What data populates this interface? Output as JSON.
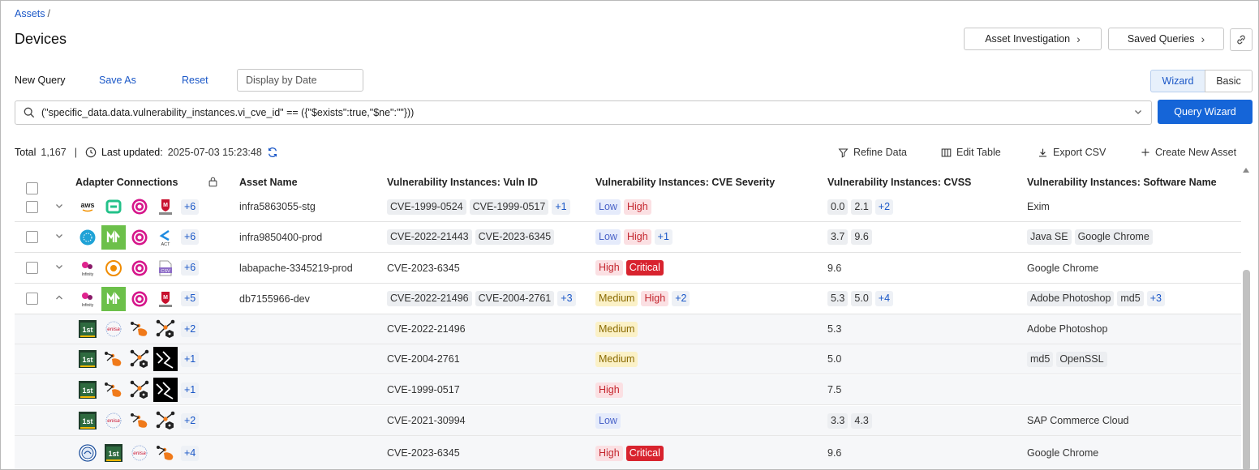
{
  "breadcrumb": {
    "root": "Assets",
    "sep": "/"
  },
  "page_title": "Devices",
  "header_buttons": {
    "asset_investigation": "Asset Investigation",
    "saved_queries": "Saved Queries"
  },
  "query_bar": {
    "new_query": "New Query",
    "save_as": "Save As",
    "reset": "Reset",
    "date_placeholder": "Display by Date",
    "wizard": "Wizard",
    "basic": "Basic",
    "expression": "(\"specific_data.data.vulnerability_instances.vi_cve_id\" == ({\"$exists\":true,\"$ne\":\"\"}))",
    "query_wizard": "Query Wizard"
  },
  "status": {
    "total_label": "Total",
    "total_value": "1,167",
    "updated_label": "Last updated:",
    "updated_value": "2025-07-03 15:23:48"
  },
  "toolbar": {
    "refine": "Refine Data",
    "edit_table": "Edit Table",
    "export": "Export CSV",
    "create": "Create New Asset"
  },
  "columns": {
    "adapters": "Adapter Connections",
    "asset_name": "Asset Name",
    "vuln_id": "Vulnerability Instances: Vuln ID",
    "severity": "Vulnerability Instances: CVE Severity",
    "cvss": "Vulnerability Instances: CVSS",
    "software": "Vulnerability Instances: Software Name"
  },
  "colors": {
    "accent": "#1565d8",
    "link": "#1a57c7",
    "critical": "#d8232e",
    "high_bg": "#fbe0e3",
    "medium_bg": "#fbf1c7",
    "low_bg": "#e5ebfb"
  },
  "rows": [
    {
      "expand": "down",
      "adapters": [
        "aws-icon",
        "bigfix-icon",
        "target-icon",
        "epo-icon"
      ],
      "adapters_more": "+6",
      "asset": "infra5863055-stg",
      "vuln_ids": [
        "CVE-1999-0524",
        "CVE-1999-0517"
      ],
      "vuln_more": "+1",
      "sev": [
        {
          "t": "Low",
          "k": "low"
        },
        {
          "t": "High",
          "k": "high"
        }
      ],
      "sev_more": "",
      "cvss": [
        "0.0",
        "2.1"
      ],
      "cvss_more": "+2",
      "software": [
        "Exim"
      ],
      "software_plain": true,
      "sw_more": ""
    },
    {
      "expand": "down",
      "adapters": [
        "globe-icon",
        "m-icon",
        "target-icon",
        "act-icon"
      ],
      "adapters_more": "+6",
      "asset": "infra9850400-prod",
      "vuln_ids": [
        "CVE-2022-21443",
        "CVE-2023-6345"
      ],
      "vuln_more": "",
      "sev": [
        {
          "t": "Low",
          "k": "low"
        },
        {
          "t": "High",
          "k": "high"
        }
      ],
      "sev_more": "+1",
      "cvss": [
        "3.7",
        "9.6"
      ],
      "cvss_more": "",
      "software": [
        "Java SE",
        "Google Chrome"
      ],
      "software_plain": false,
      "sw_more": ""
    },
    {
      "expand": "down",
      "adapters": [
        "infinity-icon",
        "sun-icon",
        "target-icon",
        "csv-icon"
      ],
      "adapters_more": "+6",
      "asset": "labapache-3345219-prod",
      "vuln_ids": [
        "CVE-2023-6345"
      ],
      "vuln_plain": true,
      "vuln_more": "",
      "sev": [
        {
          "t": "High",
          "k": "high"
        },
        {
          "t": "Critical",
          "k": "crit"
        }
      ],
      "sev_more": "",
      "cvss": [
        "9.6"
      ],
      "cvss_plain": true,
      "cvss_more": "",
      "software": [
        "Google Chrome"
      ],
      "software_plain": true,
      "sw_more": ""
    },
    {
      "expand": "up",
      "adapters": [
        "infinity-icon",
        "m-icon",
        "target-icon",
        "epo-icon"
      ],
      "adapters_more": "+5",
      "asset": "db7155966-dev",
      "vuln_ids": [
        "CVE-2022-21496",
        "CVE-2004-2761"
      ],
      "vuln_more": "+3",
      "sev": [
        {
          "t": "Medium",
          "k": "med"
        },
        {
          "t": "High",
          "k": "high"
        }
      ],
      "sev_more": "+2",
      "cvss": [
        "5.3",
        "5.0"
      ],
      "cvss_more": "+4",
      "software": [
        "Adobe Photoshop",
        "md5"
      ],
      "software_plain": false,
      "sw_more": "+3"
    }
  ],
  "sub_rows": [
    {
      "adapters": [
        "first-icon",
        "enisa-icon",
        "hand-icon",
        "nodes-icon"
      ],
      "adapters_more": "+2",
      "vuln_id": "CVE-2022-21496",
      "sev": [
        {
          "t": "Medium",
          "k": "med"
        }
      ],
      "cvss": [
        "5.3"
      ],
      "cvss_plain": true,
      "software": [
        "Adobe Photoshop"
      ],
      "software_plain": true
    },
    {
      "adapters": [
        "first-icon",
        "hand-icon",
        "nodes-icon",
        "dark-icon"
      ],
      "adapters_more": "+1",
      "vuln_id": "CVE-2004-2761",
      "sev": [
        {
          "t": "Medium",
          "k": "med"
        }
      ],
      "cvss": [
        "5.0"
      ],
      "cvss_plain": true,
      "software": [
        "md5",
        "OpenSSL"
      ],
      "software_plain": false
    },
    {
      "adapters": [
        "first-icon",
        "hand-icon",
        "nodes-icon",
        "dark-icon"
      ],
      "adapters_more": "+1",
      "vuln_id": "CVE-1999-0517",
      "sev": [
        {
          "t": "High",
          "k": "high"
        }
      ],
      "cvss": [
        "7.5"
      ],
      "cvss_plain": true,
      "software": [],
      "software_plain": true
    },
    {
      "adapters": [
        "first-icon",
        "enisa-icon",
        "hand-icon",
        "nodes-icon"
      ],
      "adapters_more": "+2",
      "vuln_id": "CVE-2021-30994",
      "sev": [
        {
          "t": "Low",
          "k": "low"
        }
      ],
      "cvss": [
        "3.3",
        "4.3"
      ],
      "cvss_plain": false,
      "software": [
        "SAP Commerce Cloud"
      ],
      "software_plain": true
    },
    {
      "adapters": [
        "seal-icon",
        "first-icon",
        "enisa-icon",
        "hand-icon"
      ],
      "adapters_more": "+4",
      "vuln_id": "CVE-2023-6345",
      "sev": [
        {
          "t": "High",
          "k": "high"
        },
        {
          "t": "Critical",
          "k": "crit"
        }
      ],
      "cvss": [
        "9.6"
      ],
      "cvss_plain": true,
      "software": [
        "Google Chrome"
      ],
      "software_plain": true
    }
  ]
}
